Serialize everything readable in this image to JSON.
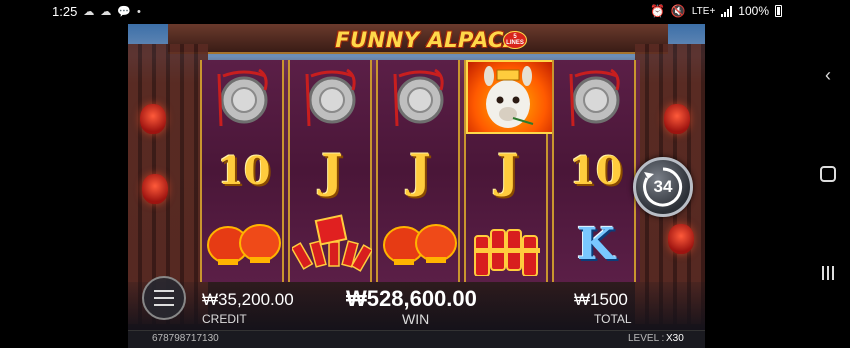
{
  "status_bar": {
    "time": "1:25",
    "network": "LTE+",
    "battery": "100%",
    "icons": [
      "clock-icon",
      "cloud-icon",
      "chat-icon",
      "dot-icon",
      "alarm-icon",
      "mute-icon",
      "signal-icon",
      "battery-icon"
    ]
  },
  "game": {
    "title": "FUNNY ALPACA",
    "lines_badge": "5 LINES",
    "spin_count": "34",
    "reels": [
      [
        "gong",
        "10",
        "lanterns"
      ],
      [
        "gong",
        "J",
        "firecrackers"
      ],
      [
        "gong",
        "J",
        "lanterns"
      ],
      [
        "alpaca",
        "J",
        "firecracker-bundle"
      ],
      [
        "gong",
        "10",
        "K"
      ]
    ],
    "credit": {
      "value": "₩35,200.00",
      "label": "CREDIT"
    },
    "win": {
      "value": "₩528,600.00",
      "label": "WIN"
    },
    "total": {
      "value": "₩1500",
      "label": "TOTAL"
    },
    "footer": {
      "id": "678798717130",
      "level_label": "LEVEL :",
      "level_value": "X30"
    }
  },
  "nav": {
    "buttons": [
      "back-icon",
      "home-icon",
      "recents-icon"
    ]
  },
  "colors": {
    "gold": "#ffcc3d",
    "reel_bg": "#4a1638",
    "frame": "#c9962e",
    "k_blue": "#79c8ff"
  }
}
